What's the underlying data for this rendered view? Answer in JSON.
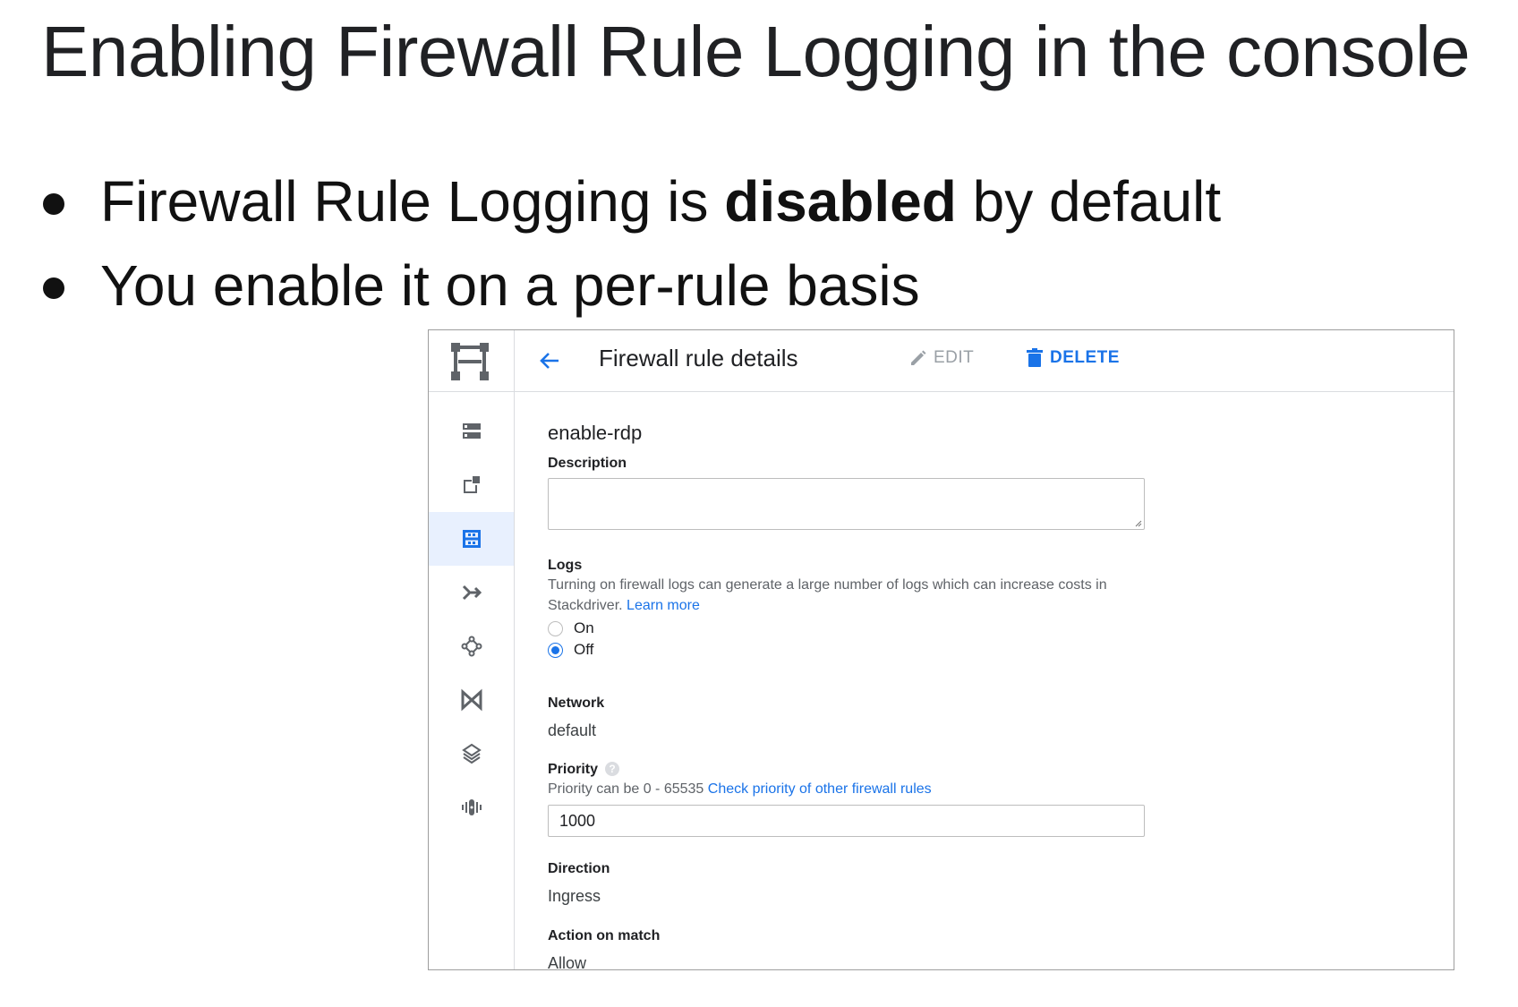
{
  "slide": {
    "title": "Enabling Firewall Rule Logging in the console",
    "bullet1": {
      "before": "Firewall Rule Logging is ",
      "bold": "disabled",
      "after": " by default"
    },
    "bullet2": "You enable it on a per-rule basis"
  },
  "console": {
    "rail": {
      "logo_icon": "vpc-network-logo-icon",
      "items": [
        {
          "icon": "vpc-networks-icon",
          "active": false
        },
        {
          "icon": "external-ip-icon",
          "active": false
        },
        {
          "icon": "firewall-rules-icon",
          "active": true
        },
        {
          "icon": "routes-icon",
          "active": false
        },
        {
          "icon": "vpc-peering-icon",
          "active": false
        },
        {
          "icon": "shared-vpc-icon",
          "active": false
        },
        {
          "icon": "serverless-vpc-access-icon",
          "active": false
        },
        {
          "icon": "packet-mirroring-icon",
          "active": false
        }
      ]
    },
    "topbar": {
      "back_icon": "arrow-back-icon",
      "title": "Firewall rule details",
      "edit_label": "EDIT",
      "delete_label": "DELETE"
    },
    "form": {
      "rule_name": "enable-rdp",
      "description_label": "Description",
      "description_value": "",
      "logs_label": "Logs",
      "logs_hint": "Turning on firewall logs can generate a large number of logs which can increase costs in Stackdriver.",
      "logs_learn_more": "Learn more",
      "logs_options": [
        {
          "label": "On",
          "checked": false
        },
        {
          "label": "Off",
          "checked": true
        }
      ],
      "network_label": "Network",
      "network_value": "default",
      "priority_label": "Priority",
      "priority_hint": "Priority can be 0 - 65535",
      "priority_link": "Check priority of other firewall rules",
      "priority_value": "1000",
      "direction_label": "Direction",
      "direction_value": "Ingress",
      "action_label": "Action on match",
      "action_value": "Allow"
    },
    "colors": {
      "accent": "#1a73e8",
      "border": "#dadce0",
      "active_rail": "#e8f0fe"
    }
  }
}
